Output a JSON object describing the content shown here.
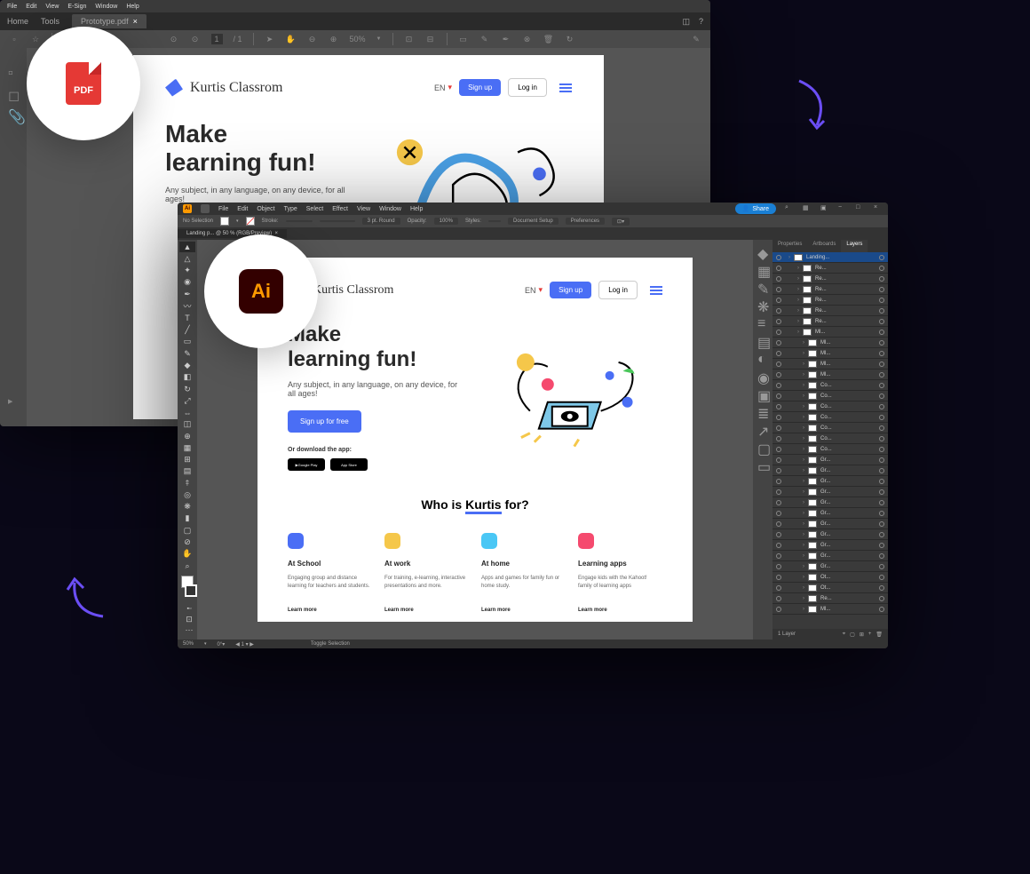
{
  "acrobat": {
    "menu": [
      "File",
      "Edit",
      "View",
      "E-Sign",
      "Window",
      "Help"
    ],
    "tabs": {
      "home": "Home",
      "tools": "Tools",
      "doc": "Prototype.pdf"
    },
    "toolbar": {
      "page": "1",
      "of": "/ 1",
      "zoom": "50%"
    }
  },
  "illustrator": {
    "menu": [
      "File",
      "Edit",
      "Object",
      "Type",
      "Select",
      "Effect",
      "View",
      "Window",
      "Help"
    ],
    "share": "Share",
    "options": {
      "nosel": "No Selection",
      "stroke": "Stroke:",
      "pt": "3 pt. Round",
      "opacity": "Opacity:",
      "opval": "100%",
      "styles": "Styles:",
      "docsetup": "Document Setup",
      "prefs": "Preferences"
    },
    "tab": "Landing p...                              @ 50 % (RGB/Preview)",
    "panels": {
      "p1": "Properties",
      "p2": "Artboards",
      "p3": "Layers"
    },
    "layers": [
      "Landing...",
      "Re...",
      "Re...",
      "Re...",
      "Re...",
      "Re...",
      "Re...",
      "Ml...",
      "Ml...",
      "Ml...",
      "Ml...",
      "Ml...",
      "Co...",
      "Co...",
      "Co...",
      "Co...",
      "Co...",
      "Co...",
      "Co...",
      "Gr...",
      "Gr...",
      "Gr...",
      "Gr...",
      "Gr...",
      "Gr...",
      "Gr...",
      "Gr...",
      "Gr...",
      "Gr...",
      "Gr...",
      "Ot...",
      "Ot...",
      "Re...",
      "Ml..."
    ],
    "layerfoot": "1 Layer",
    "status": {
      "zoom": "50%",
      "toggle": "Toggle Selection"
    }
  },
  "webpage": {
    "brand": "Kurtis Classrom",
    "lang": "EN",
    "signup": "Sign up",
    "login": "Log in",
    "h1a": "Make",
    "h1b": "learning fun!",
    "sub": "Any subject, in any language, on any device, for all ages!",
    "cta": "Sign up for free",
    "download": "Or download the app:",
    "store1": "Google Play",
    "store2": "App Store",
    "who": "Who is Kurtis for?",
    "cards": [
      {
        "t": "At School",
        "d": "Engaging group and distance learning for teachers and students.",
        "l": "Learn more",
        "c": "#4a6ef5"
      },
      {
        "t": "At work",
        "d": "For training, e-learning, interactive presentations and more.",
        "l": "Learn more",
        "c": "#f5c74a"
      },
      {
        "t": "At home",
        "d": "Apps and games for family fun or home study.",
        "l": "Learn more",
        "c": "#4ac7f5"
      },
      {
        "t": "Learning apps",
        "d": "Engage kids with the Kahoot! family of learning apps",
        "l": "Learn more",
        "c": "#f54a6e"
      }
    ]
  },
  "badges": {
    "pdf": "PDF",
    "ai": "Ai"
  }
}
